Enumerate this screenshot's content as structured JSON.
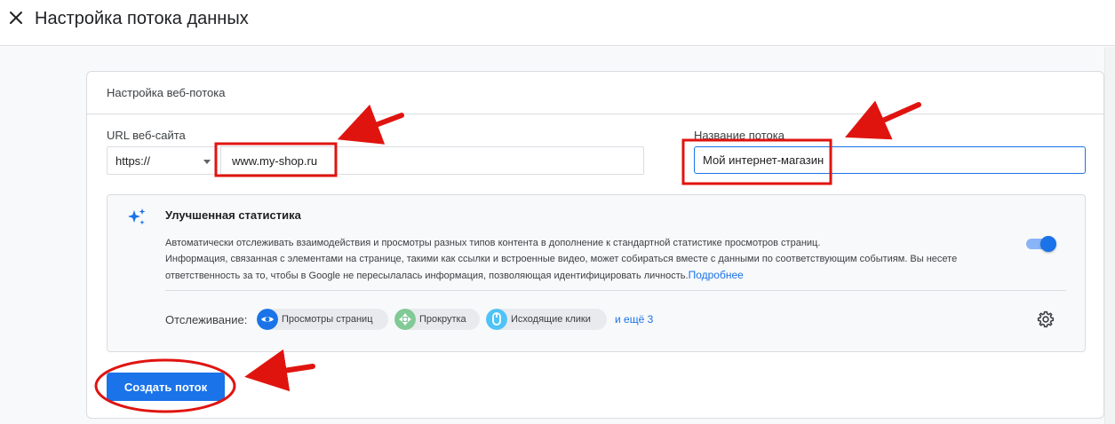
{
  "header": {
    "title": "Настройка потока данных",
    "close_icon": "close-icon"
  },
  "card": {
    "title": "Настройка веб-потока",
    "url_label": "URL веб-сайта",
    "protocol_value": "https://",
    "url_value": "www.my-shop.ru",
    "name_label": "Название потока",
    "name_value": "Мой интернет-магазин"
  },
  "enhanced": {
    "title": "Улучшенная статистика",
    "description_1": "Автоматически отслеживать взаимодействия и просмотры разных типов контента в дополнение к стандартной статистике просмотров страниц.",
    "description_2": "Информация, связанная с элементами на странице, такими как ссылки и встроенные видео, может собираться вместе с данными по соответствующим событиям. Вы несете ответственность за то, чтобы в Google не пересылалась информация, позволяющая идентифицировать личность.",
    "more_link": "Подробнее",
    "toggle_on": true,
    "tracking_label": "Отслеживание:",
    "chips": [
      {
        "label": "Просмотры страниц",
        "icon": "eye-icon",
        "color": "#1a73e8"
      },
      {
        "label": "Прокрутка",
        "icon": "scroll-icon",
        "color": "#81c995"
      },
      {
        "label": "Исходящие клики",
        "icon": "mouse-icon",
        "color": "#4fc3f7"
      }
    ],
    "more_chips": "и ещё 3"
  },
  "actions": {
    "create_label": "Создать поток"
  },
  "colors": {
    "primary": "#1a73e8",
    "annotation": "#e0140f"
  }
}
